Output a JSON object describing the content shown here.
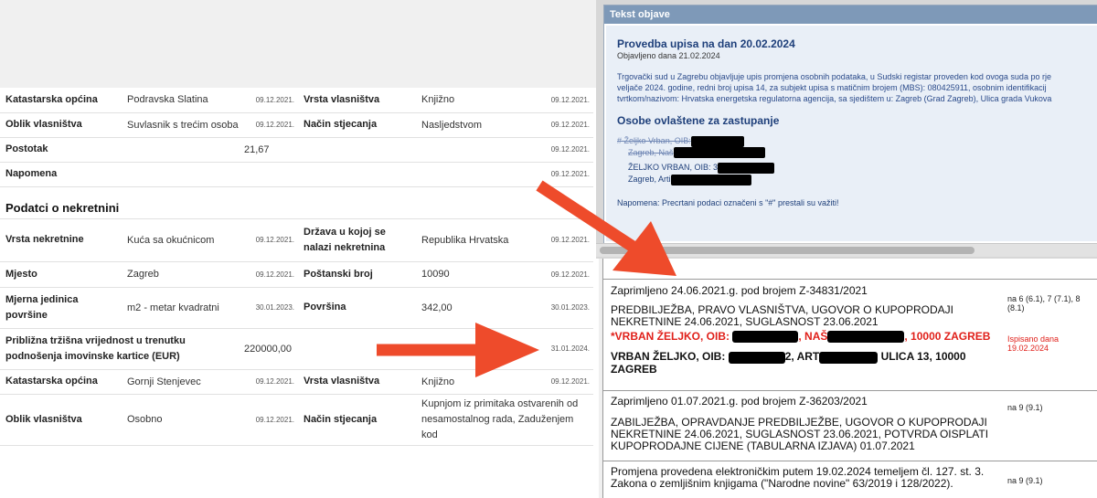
{
  "property_table": {
    "rows_top": [
      {
        "l1": "Katastarska općina",
        "v1": "Podravska Slatina",
        "d1": "09.12.2021.",
        "l2": "Vrsta vlasništva",
        "v2": "Knjižno",
        "d2": "09.12.2021."
      },
      {
        "l1": "Oblik vlasništva",
        "v1": "Suvlasnik s trećim osobama",
        "d1": "09.12.2021.",
        "l2": "Način stjecanja",
        "v2": "Nasljedstvom",
        "d2": "09.12.2021."
      }
    ],
    "postotak": {
      "label": "Postotak",
      "value": "21,67",
      "date": "09.12.2021."
    },
    "napomena": {
      "label": "Napomena",
      "date": "09.12.2021."
    },
    "section_title": "Podatci o nekretnini",
    "vrsta": {
      "l1": "Vrsta nekretnine",
      "v1": "Kuća sa okućnicom",
      "d1": "09.12.2021.",
      "l2": "Država u kojoj se nalazi nekretnina",
      "v2": "Republika Hrvatska",
      "d2": "09.12.2021."
    },
    "mjesto": {
      "l1": "Mjesto",
      "v1": "Zagreb",
      "d1": "09.12.2021.",
      "l2": "Poštanski broj",
      "v2": "10090",
      "d2": "09.12.2021."
    },
    "mjerna": {
      "l1": "Mjerna jedinica površine",
      "v1": "m2 - metar kvadratni",
      "d1": "30.01.2023.",
      "l2": "Površina",
      "v2": "342,00",
      "d2": "30.01.2023."
    },
    "trzisna": {
      "label": "Približna tržišna vrijednost u trenutku podnošenja imovinske kartice (EUR)",
      "value": "220000,00",
      "date": "31.01.2024."
    },
    "kat2": {
      "l1": "Katastarska općina",
      "v1": "Gornji Stenjevec",
      "d1": "09.12.2021.",
      "l2": "Vrsta vlasništva",
      "v2": "Knjižno",
      "d2": "09.12.2021."
    },
    "oblik2": {
      "l1": "Oblik vlasništva",
      "v1": "Osobno",
      "d1": "09.12.2021.",
      "l2": "Način stjecanja",
      "v2": "Kupnjom iz primitaka ostvarenih od nesamostalnog rada, Zaduženjem kod"
    }
  },
  "notice": {
    "header": "Tekst objave",
    "title": "Provedba upisa na dan 20.02.2024",
    "published": "Objavljeno dana 21.02.2024",
    "text_line1": "Trgovački sud u Zagrebu objavljuje upis promjena osobnih podataka, u Sudski registar proveden kod ovoga suda po rje",
    "text_line2": "veljače 2024. godine, redni broj upisa 14, za subjekt upisa s matičnim brojem (MBS): 080425911, osobnim identifikacij",
    "text_line3": "tvrtkom/nazivom: Hrvatska energetska regulatorna agencija, sa sjedištem u: Zagreb (Grad Zagreb), Ulica grada Vukova",
    "persons_title": "Osobe ovlaštene za zastupanje",
    "old_line1": "# Željko Vrban, OIB:",
    "old_line2": "Zagreb, Naš",
    "new_line1": "ŽELJKO VRBAN, OIB: 3",
    "new_line2": "Zagreb, Arti",
    "note": "Napomena: Precrtani podaci označeni s \"#\" prestali su važiti!"
  },
  "registry": {
    "e1_received": "Zaprimljeno 24.06.2021.g. pod brojem Z-34831/2021",
    "e1_ref": "na 6 (6.1), 7 (7.1), 8 (8.1)",
    "e1_desc1": "PREDBILJEŽBA, PRAVO VLASNIŠTVA, UGOVOR O KUPOPRODAJI",
    "e1_desc2": "NEKRETNINE 24.06.2021, SUGLASNOST 23.06.2021",
    "e1_red_a": "*VRBAN ŽELJKO, OIB:",
    "e1_red_b": ", NAŠ",
    "e1_red_c": ", 10000 ZAGREB",
    "e1_red_ref1": "Ispisano dana",
    "e1_red_ref2": "19.02.2024",
    "e1_new_a": "VRBAN ŽELJKO, OIB:",
    "e1_new_b": "2, ART",
    "e1_new_c": " ULICA 13, 10000",
    "e1_new_d": "ZAGREB",
    "e2_received": "Zaprimljeno 01.07.2021.g. pod brojem Z-36203/2021",
    "e2_ref": "na 9 (9.1)",
    "e2_desc1": "ZABILJEŽBA, OPRAVDANJE PREDBILJEŽBE, UGOVOR O KUPOPRODAJI",
    "e2_desc2": "NEKRETNINE 24.06.2021, SUGLASNOST 23.06.2021, POTVRDA OISPLATI",
    "e2_desc3": "KUPOPRODAJNE CIJENE (TABULARNA IZJAVA) 01.07.2021",
    "e3_text1": "Promjena provedena elektroničkim putem 19.02.2024 temeljem čl. 127. st. 3.",
    "e3_text2": "Zakona o zemljišnim knjigama (\"Narodne novine\" 63/2019 i 128/2022).",
    "e3_ref": "na 9 (9.1)"
  },
  "colors": {
    "arrow": "#ee4b2b",
    "redact": "#000000",
    "notice_header": "#7e99b8",
    "registry_red": "#e0201a"
  },
  "icons": [
    "arrow-to-registry-icon",
    "arrow-to-date-icon"
  ]
}
